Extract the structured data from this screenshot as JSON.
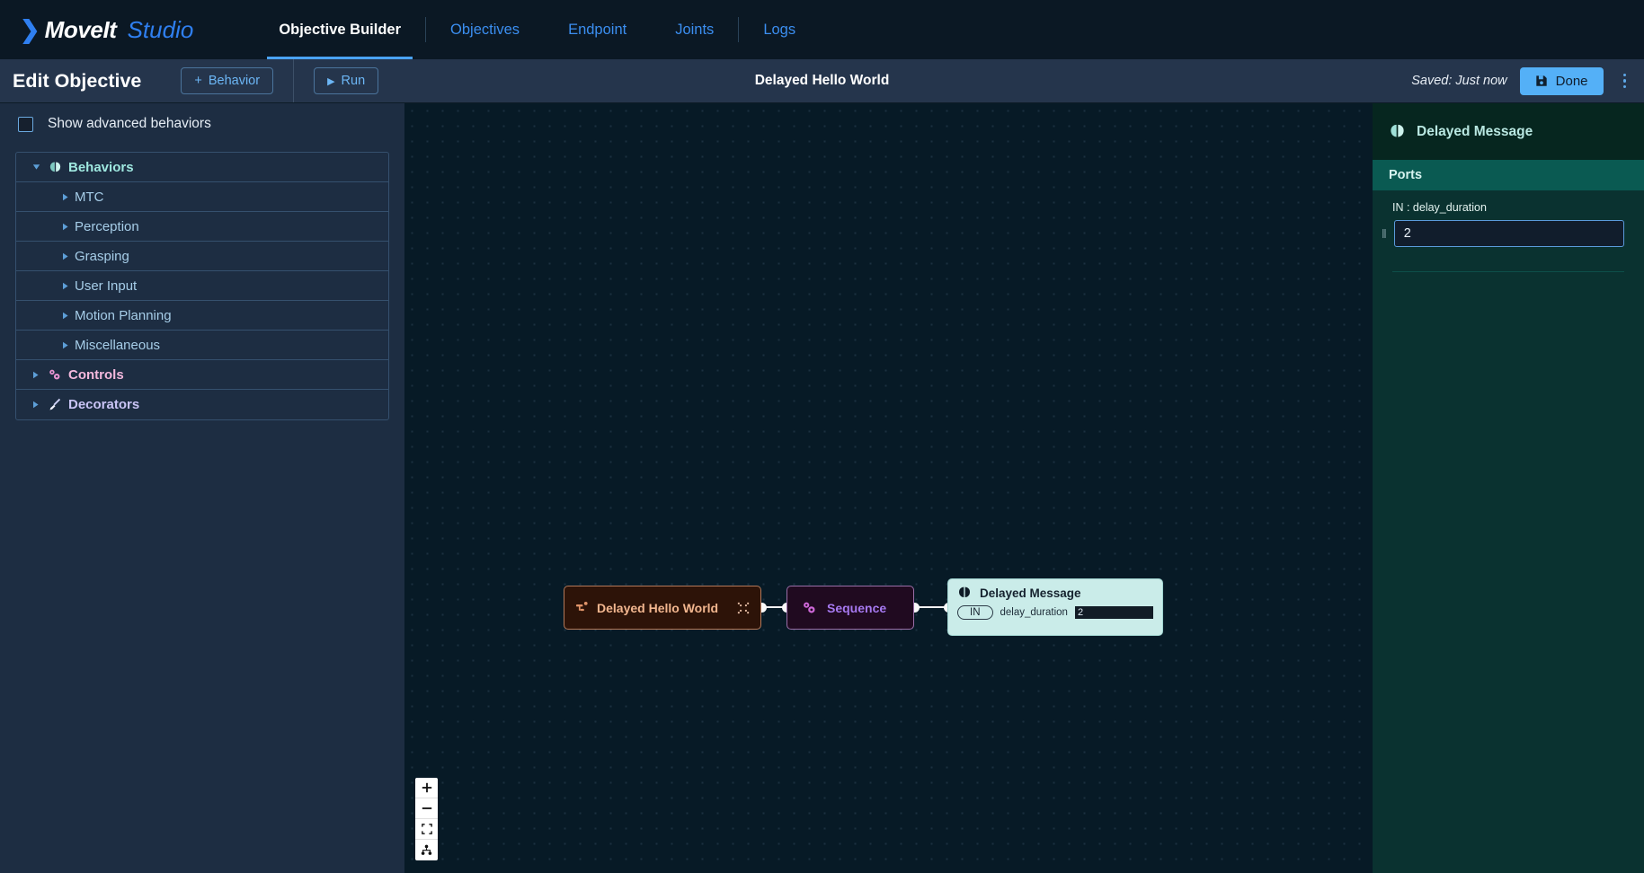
{
  "brand": {
    "chevron": "❯",
    "name_bold": "MoveIt",
    "name_light": "Studio"
  },
  "nav": {
    "tabs": [
      {
        "label": "Objective Builder",
        "active": true
      },
      {
        "label": "Objectives",
        "active": false
      },
      {
        "label": "Endpoint",
        "active": false
      },
      {
        "label": "Joints",
        "active": false
      },
      {
        "label": "Logs",
        "active": false
      }
    ]
  },
  "toolbar": {
    "edit_title": "Edit Objective",
    "behavior_button": "Behavior",
    "behavior_plus": "+",
    "run_button": "Run",
    "run_glyph": "▶",
    "document_title": "Delayed Hello World",
    "saved_status": "Saved: Just now",
    "done_button": "Done"
  },
  "sidebar": {
    "advanced_checkbox_label": "Show advanced behaviors",
    "advanced_checked": false,
    "tree": [
      {
        "label": "Behaviors",
        "level": "root",
        "expanded": true,
        "icon": "brain-icon",
        "color_class": "c-behaviors"
      },
      {
        "label": "MTC",
        "level": "child",
        "expanded": false,
        "icon": "none",
        "color_class": "c-child"
      },
      {
        "label": "Perception",
        "level": "child",
        "expanded": false,
        "icon": "none",
        "color_class": "c-child"
      },
      {
        "label": "Grasping",
        "level": "child",
        "expanded": false,
        "icon": "none",
        "color_class": "c-child"
      },
      {
        "label": "User Input",
        "level": "child",
        "expanded": false,
        "icon": "none",
        "color_class": "c-child"
      },
      {
        "label": "Motion Planning",
        "level": "child",
        "expanded": false,
        "icon": "none",
        "color_class": "c-child"
      },
      {
        "label": "Miscellaneous",
        "level": "child",
        "expanded": false,
        "icon": "none",
        "color_class": "c-child"
      },
      {
        "label": "Controls",
        "level": "root",
        "expanded": false,
        "icon": "gears-icon",
        "color_class": "c-controls"
      },
      {
        "label": "Decorators",
        "level": "root",
        "expanded": false,
        "icon": "brush-icon",
        "color_class": "c-decorators"
      }
    ]
  },
  "canvas": {
    "nodes": {
      "root": {
        "label": "Delayed Hello World",
        "icon": "subtree-icon",
        "collapse_icon": "collapse-icon"
      },
      "sequence": {
        "label": "Sequence",
        "icon": "gears-icon"
      },
      "message": {
        "label": "Delayed Message",
        "icon": "brain-icon",
        "port_direction": "IN",
        "port_name": "delay_duration",
        "port_value": "2"
      }
    },
    "zoom_controls": [
      {
        "name": "zoom-in",
        "glyph": "+"
      },
      {
        "name": "zoom-out",
        "glyph": "−"
      },
      {
        "name": "fit-view",
        "glyph": "fit"
      },
      {
        "name": "toggle-interactivity",
        "glyph": "tree"
      }
    ]
  },
  "rightpanel": {
    "title": "Delayed Message",
    "section_header": "Ports",
    "port_label": "IN : delay_duration",
    "port_value": "2",
    "port_placeholder": "",
    "grip": "‖"
  },
  "colors": {
    "accent_blue": "#4aa3f5",
    "brand_blue": "#2f7ff0",
    "behaviors_teal": "#9fe8e0",
    "controls_pink": "#f3b8dd",
    "decorators_purple": "#c9c4f5",
    "node_root_brown": "#2d1308",
    "node_sequence_purple": "#200a20",
    "node_message_mint": "#caece9",
    "panel_teal": "#0a3230",
    "ports_header_teal": "#0a5a52"
  }
}
